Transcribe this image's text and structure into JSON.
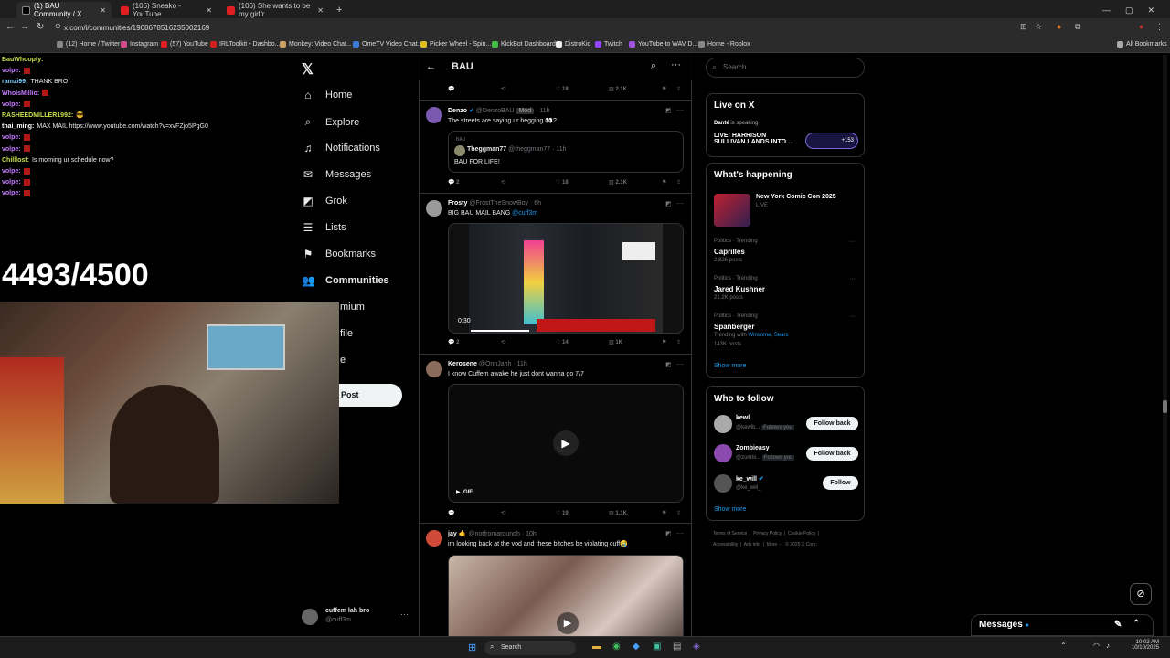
{
  "tabs": [
    {
      "title": "(1) BAU Community / X",
      "active": true
    },
    {
      "title": "(106) Sneako - YouTube",
      "active": false
    },
    {
      "title": "(106) She wants to be my girlfr",
      "active": false
    }
  ],
  "address": {
    "url": "x.com/i/communities/1908678516235002169"
  },
  "bookmarks": [
    "(12) Home / Twitter",
    "Instagram",
    "(57) YouTube",
    "IRLToolkit • Dashbo...",
    "Monkey: Video Chat...",
    "OmeTV Video Chat...",
    "Picker Wheel - Spin...",
    "KickBot Dashboard",
    "DistroKid",
    "Twitch",
    "YouTube to WAV D...",
    "Home - Roblox"
  ],
  "all_bookmarks": "All Bookmarks",
  "chat": [
    {
      "user": "BauWhoopty:",
      "msg": "",
      "color": "#c8e050",
      "red": false
    },
    {
      "user": "volpe:",
      "msg": "",
      "color": "#c47aff",
      "red": true
    },
    {
      "user": "ramzi99:",
      "msg": "THANK BRO",
      "color": "#7ad0ff",
      "red": false
    },
    {
      "user": "WhoIsMillio:",
      "msg": "",
      "color": "#c47aff",
      "red": true
    },
    {
      "user": "volpe:",
      "msg": "",
      "color": "#c47aff",
      "red": true
    },
    {
      "user": "RASHEEDMILLER1992:",
      "msg": "😎",
      "color": "#c8e050",
      "red": false
    },
    {
      "user": "thai_ming:",
      "msg": "MAX MAIL https://www.youtube.com/watch?v=xvFZjo5PgG0",
      "color": "#ffffff",
      "red": false
    },
    {
      "user": "volpe:",
      "msg": "",
      "color": "#c47aff",
      "red": true
    },
    {
      "user": "volpe:",
      "msg": "",
      "color": "#c47aff",
      "red": true
    },
    {
      "user": "Chilllost:",
      "msg": "Is morning ur schedule now?",
      "color": "#c8e050",
      "red": false
    },
    {
      "user": "volpe:",
      "msg": "",
      "color": "#c47aff",
      "red": true
    },
    {
      "user": "volpe:",
      "msg": "",
      "color": "#c47aff",
      "red": true
    },
    {
      "user": "volpe:",
      "msg": "",
      "color": "#c47aff",
      "red": true
    }
  ],
  "counter": "4493/4500",
  "nav": {
    "home": "Home",
    "explore": "Explore",
    "notifications": "Notifications",
    "messages": "Messages",
    "grok": "Grok",
    "lists": "Lists",
    "bookmarks": "Bookmarks",
    "communities": "Communities",
    "premium": "mium",
    "profile": "file",
    "more": "e",
    "post": "Post"
  },
  "account": {
    "name": "cuffem lah bro",
    "handle": "@cuff3m"
  },
  "feed": {
    "title": "BAU",
    "top_actions": {
      "views": "2.1K",
      "likes": "18"
    },
    "tweets": [
      {
        "name": "Denzo",
        "handle": "@DenzoBAU",
        "badge": "Mod",
        "time": "· 11h",
        "text": "The streets are saying ur begging 👀?",
        "quote": {
          "label": "BAU",
          "name": "Theggman77",
          "handle": "@theggman77 · 11h",
          "text": "BAU FOR LIFE!"
        },
        "replies": "2",
        "likes": "18",
        "views": "2.1K"
      },
      {
        "name": "Frosty",
        "handle": "@FrostTheSnowBoy · 6h",
        "text": "BIG BAU MAIL BANG",
        "mention": "@cuff3m",
        "video_time": "0:30",
        "replies": "2",
        "likes": "14",
        "views": "1K"
      },
      {
        "name": "Kerosene",
        "handle": "@OnnJahh · 11h",
        "text": "I know Cuffem awake he just dont wanna go 7/7",
        "gif": "GIF",
        "replies": "",
        "likes": "19",
        "views": "1.1K"
      },
      {
        "name": "jay 🤙",
        "handle": "@notfromaroundh · 10h",
        "text": "im looking back at the vod and these bitches be violating cuff😭"
      }
    ]
  },
  "right": {
    "search_placeholder": "Search",
    "live": {
      "heading": "Live on X",
      "speaker": "Danté",
      "speaking": "is speaking",
      "title1": "LIVE: HARRISON",
      "title2": "SULLIVAN LANDS INTO ...",
      "count": "+153"
    },
    "happening": {
      "heading": "What's happening",
      "event": {
        "title": "New York Comic Con 2025",
        "sub": "LIVE"
      },
      "trends": [
        {
          "cat": "Politics · Trending",
          "name": "Caprilles",
          "posts": "2,826 posts"
        },
        {
          "cat": "Politics · Trending",
          "name": "Jared Kushner",
          "posts": "21.2K posts"
        },
        {
          "cat": "Politics · Trending",
          "name": "Spanberger",
          "with_label": "Trending with",
          "with": "Winsome, Sears",
          "posts": "143K posts"
        }
      ],
      "show_more": "Show more"
    },
    "follow": {
      "heading": "Who to follow",
      "people": [
        {
          "name": "kewl",
          "handle": "@kewlb...",
          "follows": "Follows you",
          "btn": "Follow back"
        },
        {
          "name": "Zombieasy",
          "handle": "@zombi...",
          "follows": "Follows you",
          "btn": "Follow back"
        },
        {
          "name": "ke_will",
          "handle": "@ke_will_",
          "follows": "",
          "btn": "Follow"
        }
      ],
      "show_more": "Show more"
    },
    "footer1": "Terms of Service  |  Privacy Policy  |  Cookie Policy  |",
    "footer2": "Accessibility  |  Ads info  |  More ···  © 2025 X Corp."
  },
  "messages_drawer": "Messages",
  "taskbar": {
    "search": "Search",
    "time": "10:02 AM",
    "date": "10/10/2025"
  }
}
